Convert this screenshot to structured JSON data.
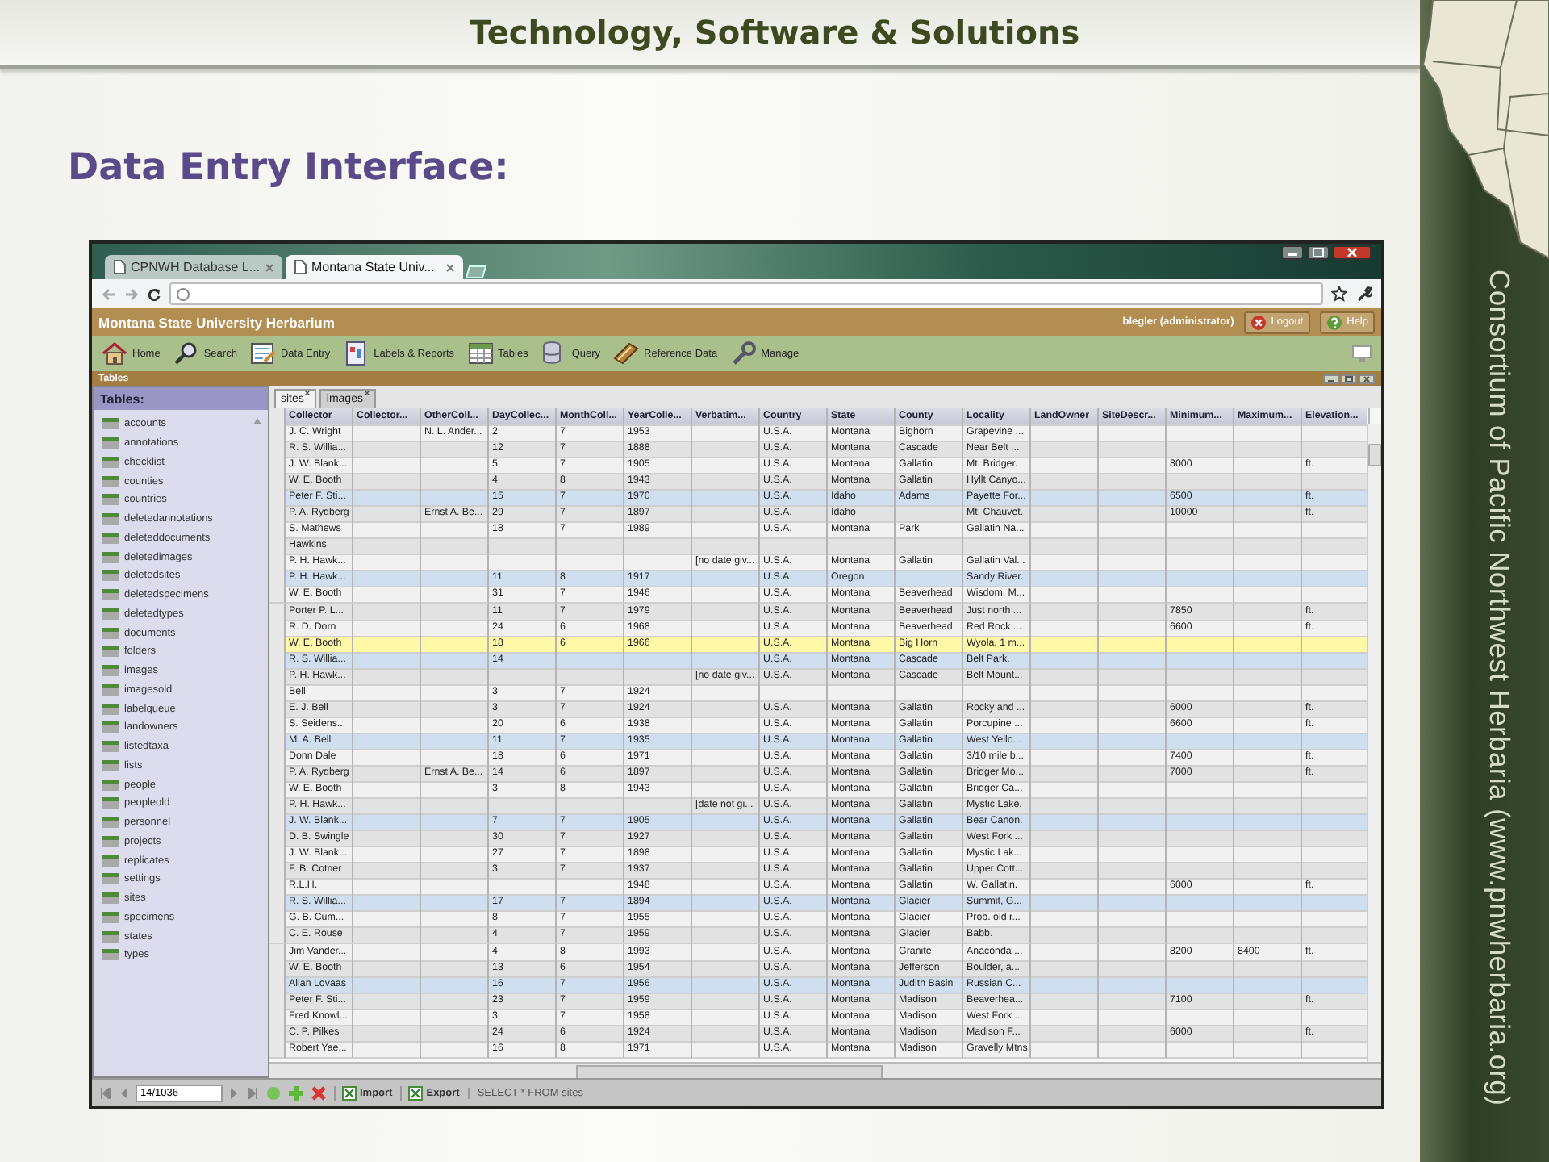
{
  "slide": {
    "title": "Technology, Software & Solutions",
    "heading": "Data Entry Interface:",
    "side_text": "Consortium of Pacific Northwest Herbaria (www.pnwherbaria.org)"
  },
  "browser": {
    "tabs": [
      {
        "label": "CPNWH Database L...",
        "selected": false
      },
      {
        "label": "Montana State Univ...",
        "selected": true
      }
    ]
  },
  "app": {
    "title": "Montana State University Herbarium",
    "user": "blegler (administrator)",
    "header_buttons": [
      "Logout",
      "Help"
    ],
    "toolbar": [
      "Home",
      "Search",
      "Data Entry",
      "Labels & Reports",
      "Tables",
      "Query",
      "Reference Data",
      "Manage"
    ],
    "panel_title": "Tables"
  },
  "sidebar": {
    "title": "Tables:",
    "items": [
      {
        "label": "accounts",
        "selected": false
      },
      {
        "label": "annotations",
        "selected": false
      },
      {
        "label": "checklist",
        "selected": false
      },
      {
        "label": "counties",
        "selected": false
      },
      {
        "label": "countries",
        "selected": false
      },
      {
        "label": "deletedannotations",
        "selected": false
      },
      {
        "label": "deleteddocuments",
        "selected": false
      },
      {
        "label": "deletedimages",
        "selected": false
      },
      {
        "label": "deletedsites",
        "selected": false
      },
      {
        "label": "deletedspecimens",
        "selected": false
      },
      {
        "label": "deletedtypes",
        "selected": false
      },
      {
        "label": "documents",
        "selected": false
      },
      {
        "label": "folders",
        "selected": false
      },
      {
        "label": "images",
        "selected": false
      },
      {
        "label": "imagesold",
        "selected": false
      },
      {
        "label": "labelqueue",
        "selected": false
      },
      {
        "label": "landowners",
        "selected": false
      },
      {
        "label": "listedtaxa",
        "selected": false
      },
      {
        "label": "lists",
        "selected": false
      },
      {
        "label": "people",
        "selected": false
      },
      {
        "label": "peopleold",
        "selected": false
      },
      {
        "label": "personnel",
        "selected": false
      },
      {
        "label": "projects",
        "selected": false
      },
      {
        "label": "replicates",
        "selected": false
      },
      {
        "label": "settings",
        "selected": false
      },
      {
        "label": "sites",
        "selected": false
      },
      {
        "label": "specimens",
        "selected": false
      },
      {
        "label": "states",
        "selected": false
      },
      {
        "label": "types",
        "selected": false
      }
    ]
  },
  "table_tabs": [
    {
      "label": "sites",
      "selected": true
    },
    {
      "label": "images",
      "selected": false
    }
  ],
  "table": {
    "columns": [
      {
        "label": "Collector"
      },
      {
        "label": "Collector..."
      },
      {
        "label": "OtherColl..."
      },
      {
        "label": "DayCollec..."
      },
      {
        "label": "MonthColl..."
      },
      {
        "label": "YearColle..."
      },
      {
        "label": "Verbatim..."
      },
      {
        "label": "Country"
      },
      {
        "label": "State"
      },
      {
        "label": "County"
      },
      {
        "label": "Locality"
      },
      {
        "label": "LandOwner"
      },
      {
        "label": "SiteDescr..."
      },
      {
        "label": "Minimum..."
      },
      {
        "label": "Maximum..."
      },
      {
        "label": "Elevation..."
      }
    ],
    "rows": [
      {
        "selected": false,
        "cells": [
          "J. C. Wright",
          null,
          "N. L. Ander...",
          "2",
          "7",
          "1953",
          null,
          "U.S.A.",
          "Montana",
          "Bighorn",
          "Grapevine ..."
        ]
      },
      {
        "selected": false,
        "cells": [
          "R. S. Willia...",
          null,
          null,
          "12",
          "7",
          "1888",
          null,
          "U.S.A.",
          "Montana",
          "Cascade",
          "Near Belt ..."
        ]
      },
      {
        "selected": false,
        "cells": [
          "J. W. Blank...",
          null,
          null,
          "5",
          "7",
          "1905",
          null,
          "U.S.A.",
          "Montana",
          "Gallatin",
          "Mt. Bridger.",
          null,
          null,
          "8000",
          null,
          "ft."
        ]
      },
      {
        "selected": false,
        "cells": [
          "W. E. Booth",
          null,
          null,
          "4",
          "8",
          "1943",
          null,
          "U.S.A.",
          "Montana",
          "Gallatin",
          "Hyllt Canyo..."
        ]
      },
      {
        "selected": false,
        "cells": [
          "Peter F. Sti...",
          null,
          null,
          "15",
          "7",
          "1970",
          null,
          "U.S.A.",
          "Idaho",
          "Adams",
          "Payette For...",
          null,
          null,
          "6500",
          null,
          "ft."
        ]
      },
      {
        "selected": false,
        "cells": [
          "P. A. Rydberg",
          null,
          "Ernst A. Be...",
          "29",
          "7",
          "1897",
          null,
          "U.S.A.",
          "Idaho",
          null,
          "Mt. Chauvet.",
          null,
          null,
          "10000",
          null,
          "ft."
        ]
      },
      {
        "selected": false,
        "cells": [
          "S. Mathews",
          null,
          null,
          "18",
          "7",
          "1989",
          null,
          "U.S.A.",
          "Montana",
          "Park",
          "Gallatin Na..."
        ]
      },
      {
        "selected": false,
        "cells": [
          "Hawkins"
        ]
      },
      {
        "selected": false,
        "cells": [
          "P. H. Hawk...",
          null,
          null,
          null,
          null,
          null,
          "[no date giv...",
          "U.S.A.",
          "Montana",
          "Gallatin",
          "Gallatin Val..."
        ]
      },
      {
        "selected": false,
        "cells": [
          "P. H. Hawk...",
          null,
          null,
          "11",
          "8",
          "1917",
          null,
          "U.S.A.",
          "Oregon",
          null,
          "Sandy River."
        ]
      },
      {
        "selected": false,
        "cells": [
          "W. E. Booth",
          null,
          null,
          "31",
          "7",
          "1946",
          null,
          "U.S.A.",
          "Montana",
          "Beaverhead",
          "Wisdom, M..."
        ]
      },
      {
        "selected": false,
        "cells": [
          "Porter P. L...",
          null,
          null,
          "11",
          "7",
          "1979",
          null,
          "U.S.A.",
          "Montana",
          "Beaverhead",
          "Just north ...",
          null,
          null,
          "7850",
          null,
          "ft."
        ]
      },
      {
        "selected": false,
        "cells": [
          "R. D. Dorn",
          null,
          null,
          "24",
          "6",
          "1968",
          null,
          "U.S.A.",
          "Montana",
          "Beaverhead",
          "Red Rock ...",
          null,
          null,
          "6600",
          null,
          "ft."
        ]
      },
      {
        "selected": true,
        "cells": [
          "W. E. Booth",
          null,
          null,
          "18",
          "6",
          "1966",
          null,
          "U.S.A.",
          "Montana",
          "Big Horn",
          "Wyola, 1 m..."
        ]
      },
      {
        "selected": false,
        "cells": [
          "R. S. Willia...",
          null,
          null,
          "14",
          null,
          null,
          null,
          "U.S.A.",
          "Montana",
          "Cascade",
          "Belt Park."
        ]
      },
      {
        "selected": false,
        "cells": [
          "P. H. Hawk...",
          null,
          null,
          null,
          null,
          null,
          "[no date giv...",
          "U.S.A.",
          "Montana",
          "Cascade",
          "Belt Mount..."
        ]
      },
      {
        "selected": false,
        "cells": [
          "Bell",
          null,
          null,
          "3",
          "7",
          "1924"
        ]
      },
      {
        "selected": false,
        "cells": [
          "E. J. Bell",
          null,
          null,
          "3",
          "7",
          "1924",
          null,
          "U.S.A.",
          "Montana",
          "Gallatin",
          "Rocky and ...",
          null,
          null,
          "6000",
          null,
          "ft."
        ]
      },
      {
        "selected": false,
        "cells": [
          "S. Seidens...",
          null,
          null,
          "20",
          "6",
          "1938",
          null,
          "U.S.A.",
          "Montana",
          "Gallatin",
          "Porcupine ...",
          null,
          null,
          "6600",
          null,
          "ft."
        ]
      },
      {
        "selected": false,
        "cells": [
          "M. A. Bell",
          null,
          null,
          "11",
          "7",
          "1935",
          null,
          "U.S.A.",
          "Montana",
          "Gallatin",
          "West Yello..."
        ]
      },
      {
        "selected": false,
        "cells": [
          "Donn Dale",
          null,
          null,
          "18",
          "6",
          "1971",
          null,
          "U.S.A.",
          "Montana",
          "Gallatin",
          "3/10 mile b...",
          null,
          null,
          "7400",
          null,
          "ft."
        ]
      },
      {
        "selected": false,
        "cells": [
          "P. A. Rydberg",
          null,
          "Ernst A. Be...",
          "14",
          "6",
          "1897",
          null,
          "U.S.A.",
          "Montana",
          "Gallatin",
          "Bridger Mo...",
          null,
          null,
          "7000",
          null,
          "ft."
        ]
      },
      {
        "selected": false,
        "cells": [
          "W. E. Booth",
          null,
          null,
          "3",
          "8",
          "1943",
          null,
          "U.S.A.",
          "Montana",
          "Gallatin",
          "Bridger Ca..."
        ]
      },
      {
        "selected": false,
        "cells": [
          "P. H. Hawk...",
          null,
          null,
          null,
          null,
          null,
          "[date not gi...",
          "U.S.A.",
          "Montana",
          "Gallatin",
          "Mystic Lake."
        ]
      },
      {
        "selected": false,
        "cells": [
          "J. W. Blank...",
          null,
          null,
          "7",
          "7",
          "1905",
          null,
          "U.S.A.",
          "Montana",
          "Gallatin",
          "Bear Canon."
        ]
      },
      {
        "selected": false,
        "cells": [
          "D. B. Swingle",
          null,
          null,
          "30",
          "7",
          "1927",
          null,
          "U.S.A.",
          "Montana",
          "Gallatin",
          "West Fork ..."
        ]
      },
      {
        "selected": false,
        "cells": [
          "J. W. Blank...",
          null,
          null,
          "27",
          "7",
          "1898",
          null,
          "U.S.A.",
          "Montana",
          "Gallatin",
          "Mystic Lak..."
        ]
      },
      {
        "selected": false,
        "cells": [
          "F. B. Cotner",
          null,
          null,
          "3",
          "7",
          "1937",
          null,
          "U.S.A.",
          "Montana",
          "Gallatin",
          "Upper Cott..."
        ]
      },
      {
        "selected": false,
        "cells": [
          "R.L.H.",
          null,
          null,
          null,
          null,
          "1948",
          null,
          "U.S.A.",
          "Montana",
          "Gallatin",
          "W. Gallatin.",
          null,
          null,
          "6000",
          null,
          "ft."
        ]
      },
      {
        "selected": false,
        "cells": [
          "R. S. Willia...",
          null,
          null,
          "17",
          "7",
          "1894",
          null,
          "U.S.A.",
          "Montana",
          "Glacier",
          "Summit, G..."
        ]
      },
      {
        "selected": false,
        "cells": [
          "G. B. Cum...",
          null,
          null,
          "8",
          "7",
          "1955",
          null,
          "U.S.A.",
          "Montana",
          "Glacier",
          "Prob. old r..."
        ]
      },
      {
        "selected": false,
        "cells": [
          "C. E. Rouse",
          null,
          null,
          "4",
          "7",
          "1959",
          null,
          "U.S.A.",
          "Montana",
          "Glacier",
          "Babb."
        ]
      },
      {
        "selected": false,
        "cells": [
          "Jim Vander...",
          null,
          null,
          "4",
          "8",
          "1993",
          null,
          "U.S.A.",
          "Montana",
          "Granite",
          "Anaconda ...",
          null,
          null,
          "8200",
          "8400",
          "ft."
        ]
      },
      {
        "selected": false,
        "cells": [
          "W. E. Booth",
          null,
          null,
          "13",
          "6",
          "1954",
          null,
          "U.S.A.",
          "Montana",
          "Jefferson",
          "Boulder, a..."
        ]
      },
      {
        "selected": false,
        "cells": [
          "Allan Lovaas",
          null,
          null,
          "16",
          "7",
          "1956",
          null,
          "U.S.A.",
          "Montana",
          "Judith Basin",
          "Russian C..."
        ]
      },
      {
        "selected": false,
        "cells": [
          "Peter F. Sti...",
          null,
          null,
          "23",
          "7",
          "1959",
          null,
          "U.S.A.",
          "Montana",
          "Madison",
          "Beaverhea...",
          null,
          null,
          "7100",
          null,
          "ft."
        ]
      },
      {
        "selected": false,
        "cells": [
          "Fred Knowl...",
          null,
          null,
          "3",
          "7",
          "1958",
          null,
          "U.S.A.",
          "Montana",
          "Madison",
          "West Fork ..."
        ]
      },
      {
        "selected": false,
        "cells": [
          "C. P. Pilkes",
          null,
          null,
          "24",
          "6",
          "1924",
          null,
          "U.S.A.",
          "Montana",
          "Madison",
          "Madison F...",
          null,
          null,
          "6000",
          null,
          "ft."
        ]
      },
      {
        "selected": false,
        "cells": [
          "Robert Yae...",
          null,
          null,
          "16",
          "8",
          "1971",
          null,
          "U.S.A.",
          "Montana",
          "Madison",
          "Gravelly Mtns."
        ]
      }
    ]
  },
  "pager": {
    "record": "14/1036",
    "buttons": [
      "Import",
      "Export"
    ],
    "query": "SELECT * FROM sites"
  }
}
